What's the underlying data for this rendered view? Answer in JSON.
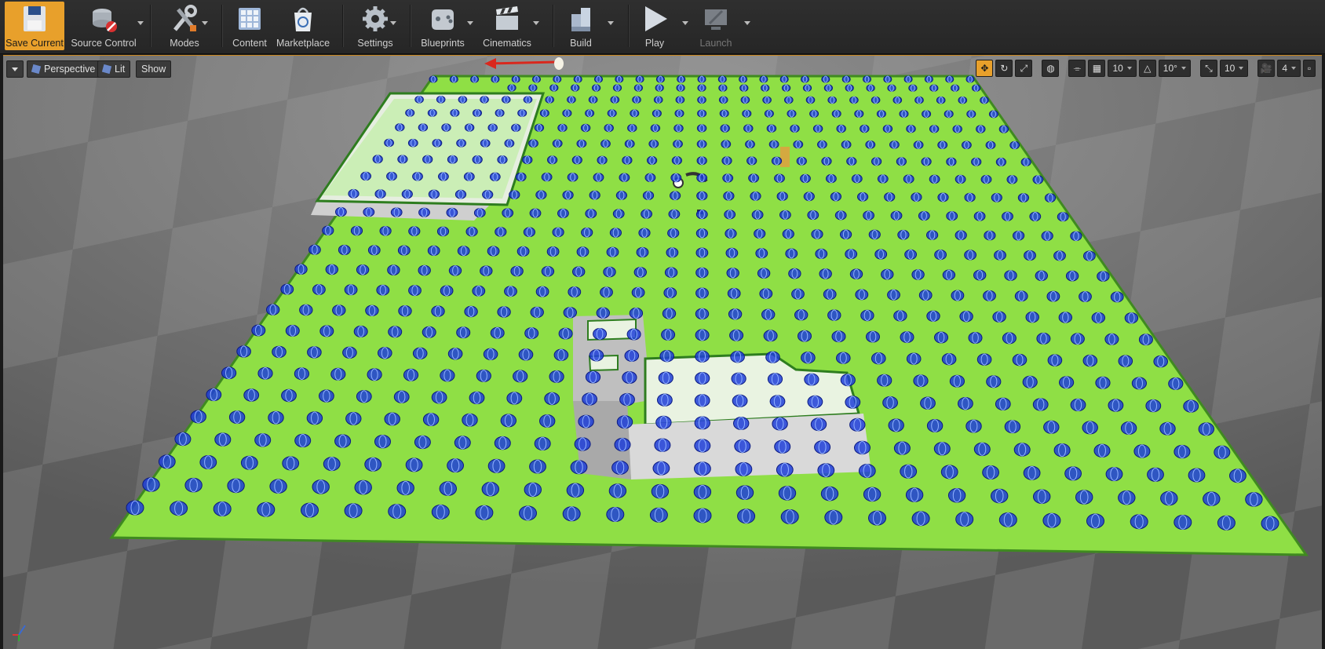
{
  "toolbar": {
    "buttons": [
      {
        "label": "Save Current",
        "icon": "save-icon"
      },
      {
        "label": "Source Control",
        "icon": "source-control-icon"
      },
      {
        "label": "Modes",
        "icon": "modes-icon"
      },
      {
        "label": "Content",
        "icon": "content-icon"
      },
      {
        "label": "Marketplace",
        "icon": "marketplace-icon"
      },
      {
        "label": "Settings",
        "icon": "settings-icon"
      },
      {
        "label": "Blueprints",
        "icon": "blueprints-icon"
      },
      {
        "label": "Cinematics",
        "icon": "cinematics-icon"
      },
      {
        "label": "Build",
        "icon": "build-icon"
      },
      {
        "label": "Play",
        "icon": "play-icon"
      },
      {
        "label": "Launch",
        "icon": "launch-icon"
      }
    ]
  },
  "viewport": {
    "view_mode": "Perspective",
    "lighting": "Lit",
    "show": "Show",
    "grid_snap": "10",
    "rotation_snap": "10°",
    "scale_snap": "10",
    "camera_speed": "4",
    "colors": {
      "floor": "#8fdf45",
      "nav_spheres": "#1f3ed8",
      "selection": "#e8a02b"
    }
  }
}
